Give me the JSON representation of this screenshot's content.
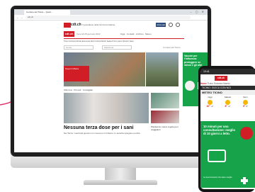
{
  "browser": {
    "tab_title": "Corriere del Ticino – Quoti...",
    "address": "cdt.ch",
    "window_buttons": "– ▢ ✕",
    "nav_arrows": "← →"
  },
  "site": {
    "brand": "cdt.ch",
    "subbrand": "Il quotidiano della Svizzera italiana",
    "header_button": "Abbonati",
    "row2_logo": "cdt.ch",
    "row2_text": "Venerdì 28 gennaio 2022",
    "row2_links": "Oggi · Contatti · Archivio · Meteo",
    "nav": "Ticino  Svizzera  Mondo  Economia  Sport  Cultura  Motori  Salute  Primo piano  Opinioni  Video",
    "search_placeholder": "Cerca",
    "search2_placeholder": "Seleziona",
    "search_right": "Corriere del Ticino",
    "promo_tile": "Scopri l'offerta",
    "cards_row": "Ultim'ora  ·  Più letti  ·  Consigliati",
    "headline": "Nessuna terza dose per i sani",
    "dek": "Nel Ticino i vaccinati giovani non ricevono il richiamo: le autorità spiegano perché.",
    "side_ad_text": "Vaccini per l'influenza: proteggere se stessi e gli altri",
    "small_card_text": "Pandemia, nuove regole per i viaggiatori"
  },
  "phone": {
    "status_time": "10:41",
    "logo": "cdt.ch",
    "tabs": [
      "Home",
      "Ticino",
      "Svizzera",
      "Mondo"
    ],
    "active_tab": "Home",
    "banner": "TICINO: GIOCA CON NOI",
    "meteo_title": "METEO TICINO",
    "weather": [
      {
        "day": "Oggi",
        "temp": "10°",
        "low": "-1°"
      },
      {
        "day": "Sabato",
        "temp": "8°",
        "low": "-2°"
      },
      {
        "day": "Dom",
        "temp": "9°",
        "low": "0°"
      }
    ],
    "ad_text": "10 minuti per una consultazione: meglio di 10 giorni a letto.",
    "ad_footer": "La tua farmacia\nti fa stare meglio"
  },
  "colors": {
    "brand_red": "#d11d25",
    "ad_green": "#16a34a",
    "accent_pink": "#e0306e"
  }
}
